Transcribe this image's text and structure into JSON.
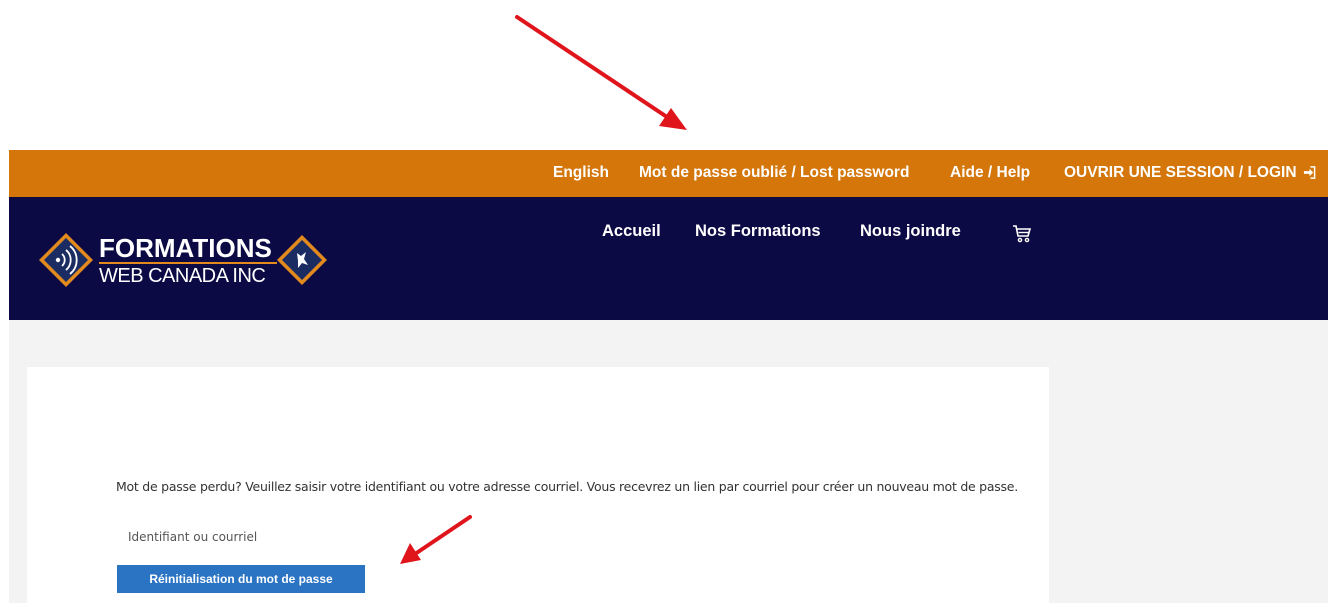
{
  "topbar": {
    "links": [
      {
        "label": "English"
      },
      {
        "label": "Mot de passe oublié / Lost password"
      },
      {
        "label": "Aide / Help"
      },
      {
        "label": "OUVRIR UNE SESSION / LOGIN"
      }
    ]
  },
  "logo": {
    "line1": "FORMATIONS",
    "line2": "WEB CANADA INC"
  },
  "nav": {
    "items": [
      {
        "label": "Accueil"
      },
      {
        "label": "Nos Formations"
      },
      {
        "label": "Nous joindre"
      }
    ],
    "cart_icon": "cart-icon"
  },
  "lost_password": {
    "intro": "Mot de passe perdu? Veuillez saisir votre identifiant ou votre adresse courriel. Vous recevrez un lien par courriel pour créer un nouveau mot de passe.",
    "field_placeholder": "Identifiant ou courriel",
    "field_value": "",
    "button_label": "Réinitialisation du mot de passe"
  },
  "colors": {
    "topbar": "#d4760a",
    "header": "#0c0a44",
    "button": "#2a74c3",
    "annotation_arrow": "#e0151c"
  }
}
